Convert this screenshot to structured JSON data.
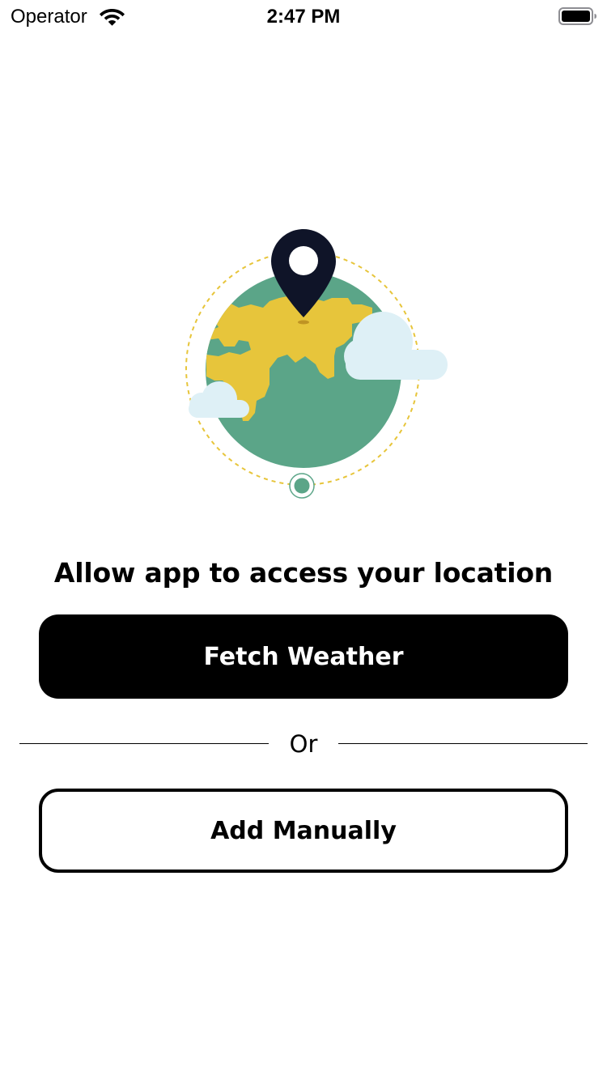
{
  "status_bar": {
    "carrier": "Operator",
    "time": "2:47 PM",
    "wifi_icon": "wifi-icon",
    "battery_icon": "battery-full-icon"
  },
  "illustration": {
    "description_icon": "globe-location-pin-illustration",
    "colors": {
      "ocean": "#5ba588",
      "land": "#e7c53b",
      "pin": "#0f1428",
      "cloud": "#def0f6",
      "orbit": "#e7c53b"
    }
  },
  "main": {
    "title": "Allow app to access your location",
    "fetch_button_label": "Fetch Weather",
    "divider_text": "Or",
    "manual_button_label": "Add Manually"
  },
  "colors": {
    "primary_button_bg": "#000000",
    "primary_button_text": "#ffffff",
    "secondary_button_border": "#000000",
    "background": "#ffffff"
  }
}
